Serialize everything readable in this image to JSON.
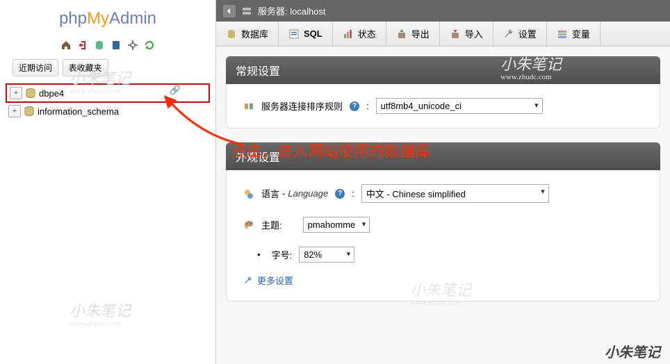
{
  "logo": {
    "php": "php",
    "my": "My",
    "admin": "Admin"
  },
  "sidebar": {
    "tabs": {
      "recent": "近期访问",
      "favorites": "表收藏夹"
    },
    "databases": [
      {
        "name": "dbpe4"
      },
      {
        "name": "information_schema"
      }
    ]
  },
  "topbar": {
    "server_label": "服务器: localhost"
  },
  "toolbar": {
    "database": "数据库",
    "sql": "SQL",
    "status": "状态",
    "export": "导出",
    "import": "导入",
    "settings": "设置",
    "variables": "变量"
  },
  "panels": {
    "general": {
      "title": "常规设置",
      "collation_label": "服务器连接排序规则",
      "collation_value": "utf8mb4_unicode_ci"
    },
    "appearance": {
      "title": "外观设置",
      "language_label": "语言",
      "language_en": "Language",
      "language_value": "中文 - Chinese simplified",
      "theme_label": "主题:",
      "theme_value": "pmahomme",
      "fontsize_label": "字号:",
      "fontsize_value": "82%",
      "more": "更多设置"
    }
  },
  "annotation": "点击，进入网站使用的数据库",
  "watermark": {
    "text": "小朱笔记",
    "url": "www.zhudc.com"
  }
}
